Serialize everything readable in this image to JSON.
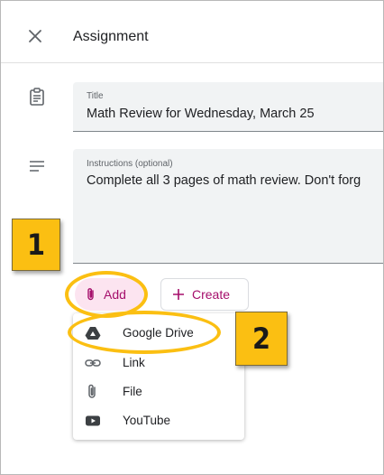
{
  "header": {
    "title": "Assignment",
    "close_icon": "close-icon"
  },
  "title_field": {
    "label": "Title",
    "value": "Math Review for Wednesday, March 25"
  },
  "instructions_field": {
    "label": "Instructions (optional)",
    "value": "Complete all 3 pages of math review. Don't forg"
  },
  "actions": {
    "add_label": "Add",
    "create_label": "Create"
  },
  "add_menu": {
    "items": [
      {
        "label": "Google Drive",
        "icon": "google-drive-icon"
      },
      {
        "label": "Link",
        "icon": "link-icon"
      },
      {
        "label": "File",
        "icon": "paperclip-icon"
      },
      {
        "label": "YouTube",
        "icon": "youtube-icon"
      }
    ]
  },
  "callouts": {
    "step1": "1",
    "step2": "2"
  },
  "colors": {
    "accent": "#a50e6b",
    "accent_bg": "#fce4f0",
    "callout": "#fbbf12"
  }
}
